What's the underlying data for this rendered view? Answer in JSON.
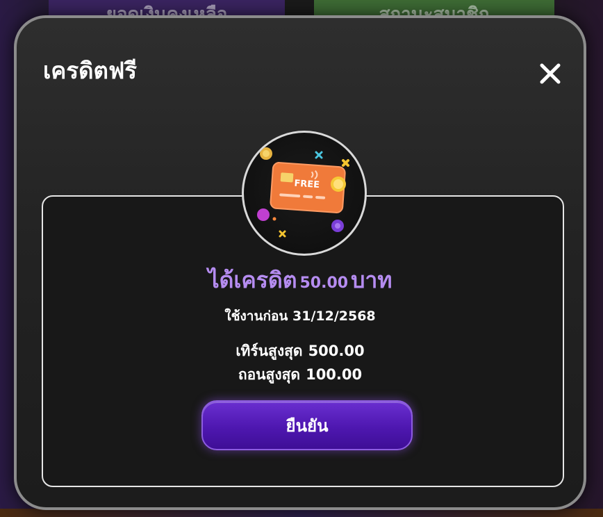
{
  "background": {
    "tab_left_label": "ยอดเงินคงเหลือ",
    "tab_right_label": "สถานะสมาชิก"
  },
  "modal": {
    "title": "เครดิตฟรี",
    "close_icon": "close-icon",
    "badge": {
      "card_text": "FREE",
      "icon": "credit-card-icon"
    },
    "credit_prefix": "ได้เครดิต",
    "credit_amount": "50.00",
    "credit_suffix": "บาท",
    "expiry_label": "ใช้งานก่อน",
    "expiry_date": "31/12/2568",
    "turnover_label": "เทิร์นสูงสุด",
    "turnover_value": "500.00",
    "withdraw_label": "ถอนสูงสุด",
    "withdraw_value": "100.00",
    "confirm_label": "ยืนยัน"
  },
  "colors": {
    "accent_purple": "#b58cf0",
    "button_purple": "#5a22c0",
    "card_orange": "#f07a3a",
    "border_gray": "#8c8c8c"
  }
}
